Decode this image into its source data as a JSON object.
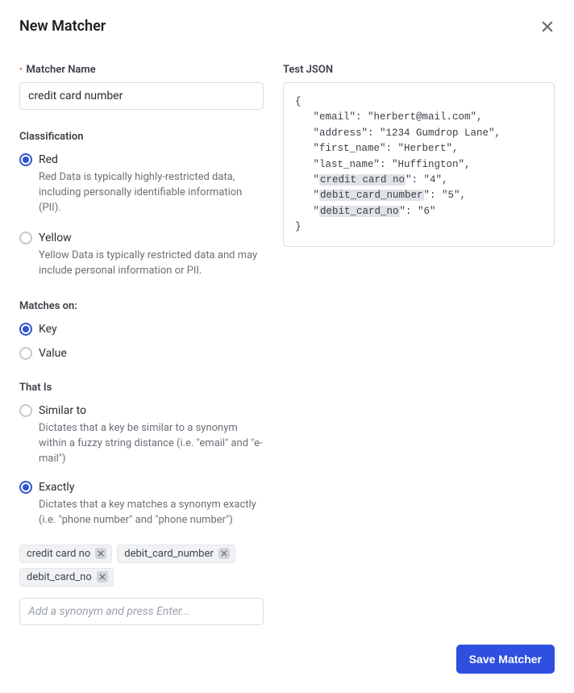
{
  "header": {
    "title": "New Matcher"
  },
  "matcher_name": {
    "label": "Matcher Name",
    "value": "credit card number"
  },
  "classification": {
    "label": "Classification",
    "options": [
      {
        "title": "Red",
        "desc": "Red Data is typically highly-restricted data, including personally identifiable information (PII).",
        "checked": true
      },
      {
        "title": "Yellow",
        "desc": "Yellow Data is typically restricted data and may include personal information or PII.",
        "checked": false
      }
    ]
  },
  "matches_on": {
    "label": "Matches on:",
    "options": [
      {
        "title": "Key",
        "checked": true
      },
      {
        "title": "Value",
        "checked": false
      }
    ]
  },
  "that_is": {
    "label": "That Is",
    "options": [
      {
        "title": "Similar to",
        "desc": "Dictates that a key be similar to a synonym within a fuzzy string distance (i.e. \"email\" and \"e-mail\")",
        "checked": false
      },
      {
        "title": "Exactly",
        "desc": "Dictates that a key matches a synonym exactly (i.e. \"phone number\" and \"phone number\")",
        "checked": true
      }
    ]
  },
  "synonyms": {
    "tags": [
      "credit card no",
      "debit_card_number",
      "debit_card_no"
    ],
    "placeholder": "Add a synonym and press Enter..."
  },
  "test_json": {
    "label": "Test JSON",
    "lines": [
      {
        "indent": 0,
        "text": "{"
      },
      {
        "indent": 1,
        "key": "email",
        "value": "\"herbert@mail.com\"",
        "comma": true
      },
      {
        "indent": 1,
        "key": "address",
        "value": "\"1234 Gumdrop Lane\"",
        "comma": true
      },
      {
        "indent": 1,
        "key": "first_name",
        "value": "\"Herbert\"",
        "comma": true
      },
      {
        "indent": 1,
        "key": "last_name",
        "value": "\"Huffington\"",
        "comma": true
      },
      {
        "indent": 1,
        "key": "credit card no",
        "value": "\"4\"",
        "comma": true,
        "highlight": true
      },
      {
        "indent": 1,
        "key": "debit_card_number",
        "value": "\"5\"",
        "comma": true,
        "highlight": true
      },
      {
        "indent": 1,
        "key": "debit_card_no",
        "value": "\"6\"",
        "comma": false,
        "highlight": true
      },
      {
        "indent": 0,
        "text": "}"
      }
    ]
  },
  "footer": {
    "save": "Save Matcher"
  }
}
